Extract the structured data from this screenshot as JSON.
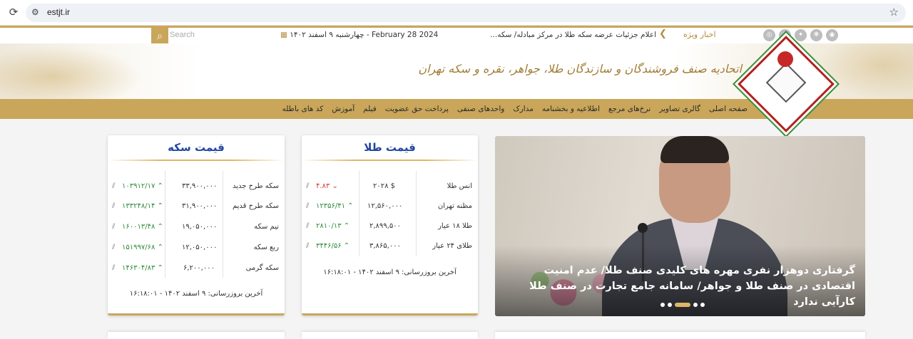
{
  "browser": {
    "url": "estjt.ir"
  },
  "topbar": {
    "news_label": "اخبار ویژه",
    "news_text": "اعلام جزئیات عرضه سکه طلا در مرکز مبادله/ سکه...",
    "date": "چهارشنبه ۹ اسفند ۱۴۰۲ - February 28 2024",
    "search_placeholder": "Search",
    "social_icons": [
      "instagram-icon",
      "telegram-icon",
      "twitter-icon",
      "aparat-icon",
      "rss-icon"
    ]
  },
  "banner": {
    "title": "اتحادیه صنف فروشندگان و سازندگان طلا، جواهر، نقره و سکه تهران"
  },
  "nav": {
    "items": [
      "صفحه اصلی",
      "گالری تصاویر",
      "نرخ‌های مرجع",
      "اطلاعیه و بخشنامه",
      "مدارک",
      "واحدهای صنفی",
      "پرداخت حق عضویت",
      "فیلم",
      "آموزش",
      "کد های باطله"
    ]
  },
  "gold": {
    "title": "قیمت طلا",
    "rows": [
      {
        "name": "انس طلا",
        "price": "۲۰۲۸ $",
        "change": "۴.۸۳",
        "dir": "down"
      },
      {
        "name": "مظنه تهران",
        "price": "۱۲,۵۶۰,۰۰۰",
        "change": "۱۲۳۵۶/۴۱",
        "dir": "up"
      },
      {
        "name": "طلا ۱۸ عیار",
        "price": "۲,۸۹۹,۵۰۰",
        "change": "۲۸۱۰/۱۳",
        "dir": "up"
      },
      {
        "name": "طلای ۲۴ عیار",
        "price": "۳,۸۶۵,۰۰۰",
        "change": "۳۴۴۶/۵۶",
        "dir": "up"
      }
    ],
    "updated": "آخرین بروزرسانی: ۹ اسفند ۱۴۰۲ - ۱۶:۱۸:۰۱"
  },
  "coin": {
    "title": "قیمت سکه",
    "rows": [
      {
        "name": "سکه طرح جدید",
        "price": "۳۳,۹۰۰,۰۰۰",
        "change": "۱۰۳۹۱۲/۱۷",
        "dir": "up"
      },
      {
        "name": "سکه طرح قدیم",
        "price": "۳۱,۹۰۰,۰۰۰",
        "change": "۱۳۳۲۴۸/۱۴",
        "dir": "up"
      },
      {
        "name": "نیم سکه",
        "price": "۱۹,۰۵۰,۰۰۰",
        "change": "۱۶۰۰۱۳/۴۸",
        "dir": "up"
      },
      {
        "name": "ربع سکه",
        "price": "۱۲,۰۵۰,۰۰۰",
        "change": "۱۵۱۹۹۷/۶۸",
        "dir": "up"
      },
      {
        "name": "سکه گرمی",
        "price": "۶,۲۰۰,۰۰۰",
        "change": "۱۴۶۳۰۴/۸۳",
        "dir": "up"
      }
    ],
    "updated": "آخرین بروزرسانی: ۹ اسفند ۱۴۰۲ - ۱۶:۱۸:۰۱"
  },
  "slider": {
    "title": "گرفتاری دوهزار نفری مهره های کلیدی صنف طلا/ عدم امنیت اقتصادی در صنف طلا و جواهر/ سامانه جامع تجارت در صنف طلا کارآیی ندارد",
    "dot_count": 5,
    "active_dot": 2
  },
  "colors": {
    "gold": "#c9a65a",
    "title_blue": "#2145a0",
    "up": "#2e8b3a",
    "down": "#d23b3b"
  }
}
